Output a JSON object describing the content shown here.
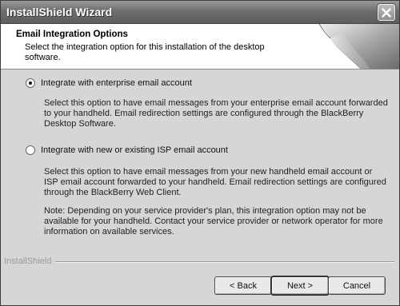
{
  "window": {
    "title": "InstallShield Wizard",
    "close_icon": "close-icon"
  },
  "header": {
    "title": "Email Integration Options",
    "subtitle": "Select the integration option for this installation of the desktop software."
  },
  "options": [
    {
      "label": "Integrate with enterprise email account",
      "selected": true,
      "description": "Select this option to have email messages from your enterprise email account forwarded to your handheld. Email redirection settings are configured through the BlackBerry Desktop Software."
    },
    {
      "label": "Integrate with new or existing ISP email account",
      "selected": false,
      "description": "Select this option to have email messages from your new handheld email account or ISP email account forwarded to your handheld. Email redirection settings are configured through the BlackBerry Web Client."
    }
  ],
  "note": "Note: Depending on your service provider's plan, this integration option may not be available for your handheld.  Contact your service provider or network operator for more information on available services.",
  "footer": {
    "brand": "InstallShield",
    "back_label": "< Back",
    "next_label": "Next >",
    "cancel_label": "Cancel"
  }
}
